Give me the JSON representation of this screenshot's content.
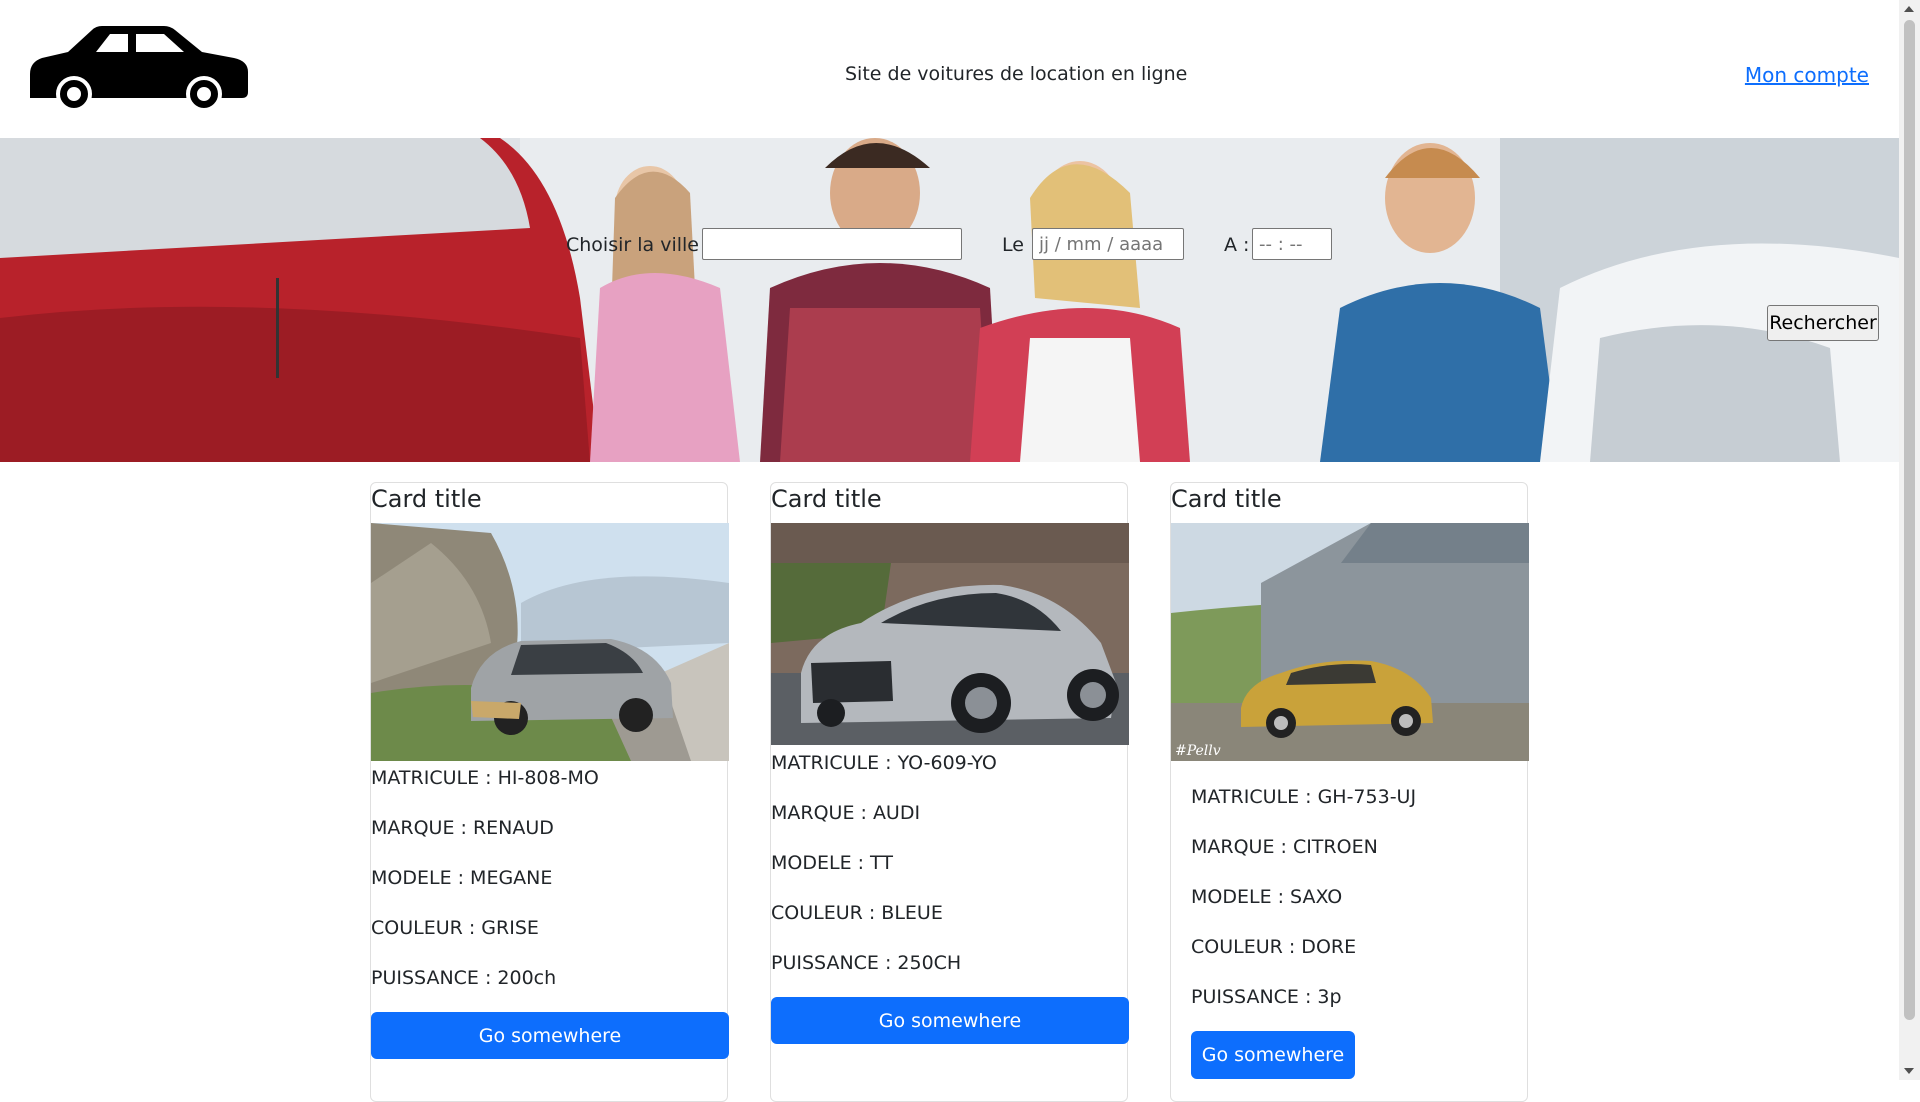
{
  "header": {
    "site_title": "Site de voitures de location en ligne",
    "account_link": "Mon compte",
    "logo_icon": "car-icon"
  },
  "search": {
    "city_label": "Choisir la ville :",
    "city_value": "",
    "date_label": "Le :",
    "date_placeholder": "jj / mm / aaaa",
    "time_label": "A :",
    "time_placeholder": "-- : --",
    "submit_label": "Rechercher"
  },
  "cards": [
    {
      "title": "Card title",
      "matricule": "MATRICULE : HI-808-MO",
      "marque": "MARQUE : RENAUD",
      "modele": "MODELE : MEGANE",
      "couleur": "COULEUR : GRISE",
      "puissance": "PUISSANCE : 200ch",
      "button": "Go somewhere"
    },
    {
      "title": "Card title",
      "matricule": "MATRICULE : YO-609-YO",
      "marque": "MARQUE : AUDI",
      "modele": "MODELE : TT",
      "couleur": "COULEUR : BLEUE",
      "puissance": "PUISSANCE : 250CH",
      "button": "Go somewhere"
    },
    {
      "title": "Card title",
      "matricule": "MATRICULE : GH-753-UJ",
      "marque": "MARQUE : CITROEN",
      "modele": "MODELE : SAXO",
      "couleur": "COULEUR : DORE",
      "puissance": "PUISSANCE : 3p",
      "button": "Go somewhere",
      "watermark": "#Pellv"
    }
  ],
  "colors": {
    "primary": "#0d6efd",
    "link": "#0d6efd",
    "text": "#212529"
  }
}
